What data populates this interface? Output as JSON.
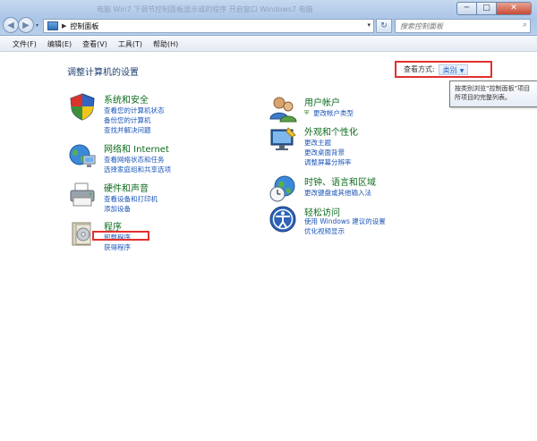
{
  "window": {
    "blurred_title": "电脑 Win7 下调节控制面板显示或的程序 开启窗口 Windows7 电脑",
    "minimize": "─",
    "maximize": "□",
    "close": "✕"
  },
  "nav": {
    "back_glyph": "◀",
    "forward_glyph": "▶",
    "dropdown_glyph": "▾"
  },
  "address": {
    "separator": "▶",
    "path": "控制面板",
    "dropdown_glyph": "▾",
    "refresh_glyph": "↻"
  },
  "search": {
    "placeholder": "搜索控制面板",
    "icon": "search-icon",
    "icon_glyph": "⌕"
  },
  "menu": {
    "items": [
      "文件(F)",
      "编辑(E)",
      "查看(V)",
      "工具(T)",
      "帮助(H)"
    ]
  },
  "page": {
    "title": "调整计算机的设置",
    "viewby_label": "查看方式:",
    "viewby_value": "类别",
    "viewby_caret": "▼",
    "tooltip_line1": "按类别浏览“控制面板”项目",
    "tooltip_line2": "所项目的完整列表。"
  },
  "categories": {
    "system": {
      "title": "系统和安全",
      "links": [
        "查看您的计算机状态",
        "备份您的计算机",
        "查找并解决问题"
      ]
    },
    "network": {
      "title": "网络和 Internet",
      "links": [
        "查看网络状态和任务",
        "选择家庭组和共享选项"
      ]
    },
    "hardware": {
      "title": "硬件和声音",
      "links": [
        "查看设备和打印机",
        "添加设备"
      ]
    },
    "programs": {
      "title": "程序",
      "links": [
        "卸载程序",
        "获得程序"
      ]
    },
    "user": {
      "title": "用户帐户",
      "links": [
        "更改帐户类型"
      ]
    },
    "appearance": {
      "title": "外观和个性化",
      "links": [
        "更改主题",
        "更改桌面背景",
        "调整屏幕分辨率"
      ]
    },
    "clock": {
      "title": "时钟、语言和区域",
      "links": [
        "更改键盘或其他输入法"
      ]
    },
    "access": {
      "title": "轻松访问",
      "links": [
        "使用 Windows 建议的设置",
        "优化视频显示"
      ]
    }
  },
  "colors": {
    "category_title": "#0e6b1e",
    "link": "#1a55b7",
    "highlight_box": "#e2302f"
  }
}
